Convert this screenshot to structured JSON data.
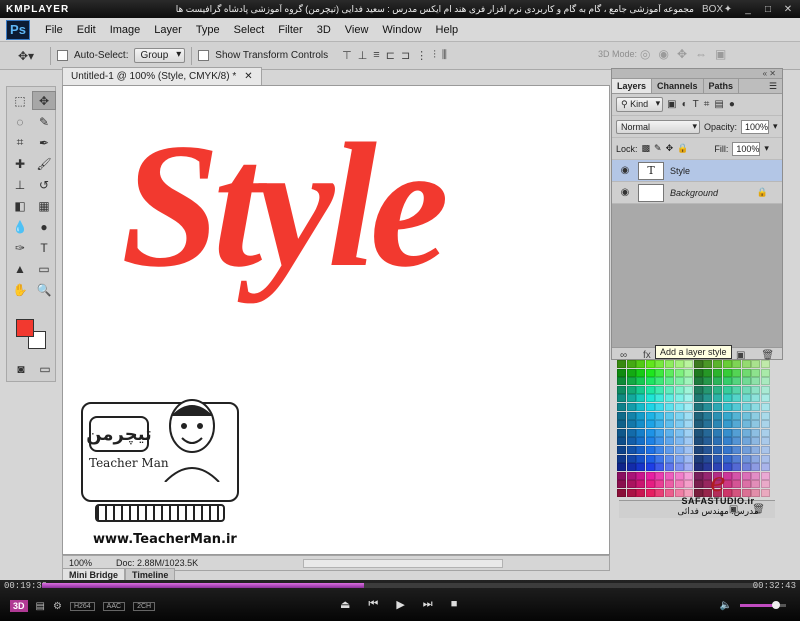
{
  "player": {
    "logo": "KMPLAYER",
    "title": "مجموعه آموزشی جامع ، گام به گام و کاربردی نرم افزار فری هند ام ایکس  مدرس : سعید فدایی (تیچرمن) گروه آموزشی پادشاه گرافیست ها",
    "box_label": "BOX",
    "elapsed": "00:19:39",
    "duration": "00:32:43",
    "progress": 0.45,
    "badges": [
      "H264",
      "AAC",
      "2CH"
    ],
    "threed_label": "3D",
    "volume": 0.75
  },
  "app": {
    "logo": "Ps",
    "menu": [
      "File",
      "Edit",
      "Image",
      "Layer",
      "Type",
      "Select",
      "Filter",
      "3D",
      "View",
      "Window",
      "Help"
    ]
  },
  "options": {
    "auto_select_label": "Auto-Select:",
    "auto_select_value": "Group",
    "show_transform_label": "Show Transform Controls",
    "mode_3d_label": "3D Mode:"
  },
  "document": {
    "tab_title": "Untitled-1 @ 100% (Style, CMYK/8) *",
    "canvas_text": "Style",
    "zoom": "100%",
    "doc_info": "Doc: 2.88M/1023.5K",
    "watermark_caption": "Teacher Man",
    "watermark_url": "www.TeacherMan.ir",
    "watermark_logo_text": "تیچرمن"
  },
  "bottom_tabs": [
    "Mini Bridge",
    "Timeline"
  ],
  "layers_panel": {
    "tabs": [
      "Layers",
      "Channels",
      "Paths"
    ],
    "filter_kind": "Kind",
    "blend_mode": "Normal",
    "opacity_label": "Opacity:",
    "opacity_value": "100%",
    "lock_label": "Lock:",
    "fill_label": "Fill:",
    "fill_value": "100%",
    "layers": [
      {
        "name": "Style",
        "thumb": "T",
        "selected": true
      },
      {
        "name": "Background",
        "thumb": "",
        "selected": false
      }
    ],
    "tooltip": "Add a layer style",
    "fx_label": "fx"
  },
  "branding": {
    "site": "SAFASTUDIO.ir",
    "teacher": "مدرس: مهندس فدائی"
  },
  "colors": {
    "accent_red": "#f2392f",
    "selected_layer": "#b3c6e6",
    "progress": "#b64bbf"
  }
}
